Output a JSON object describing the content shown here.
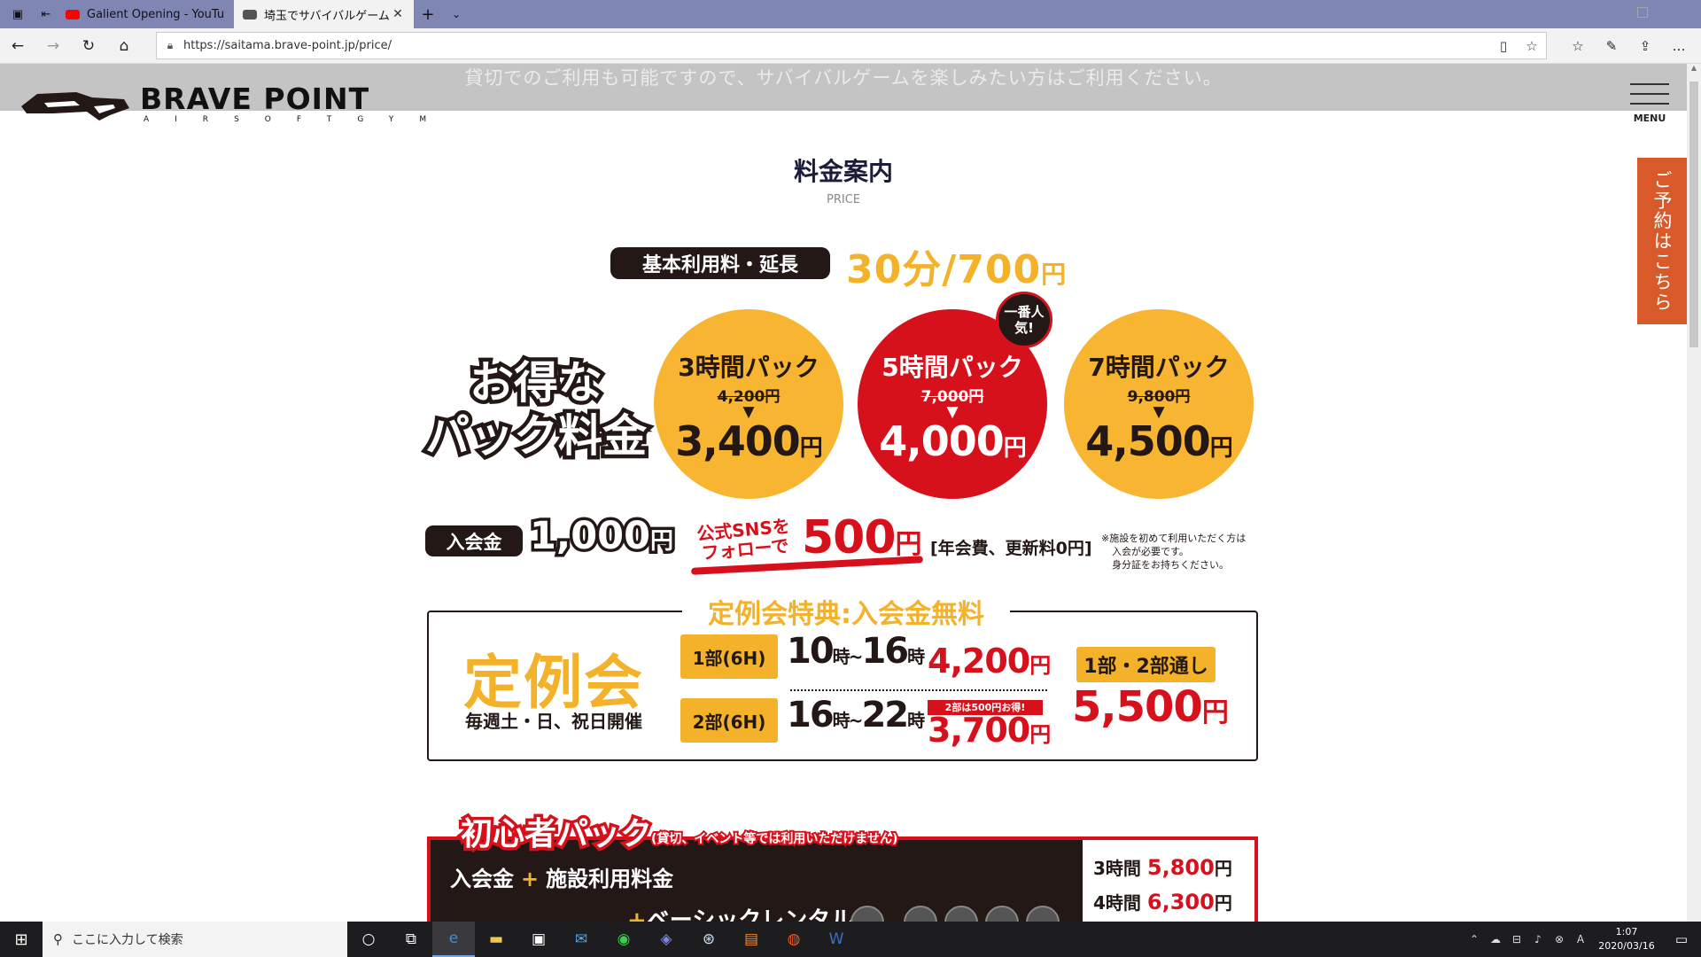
{
  "browser": {
    "tabs": [
      {
        "title": "Galient Opening - YouTube",
        "active": false
      },
      {
        "title": "埼玉でサバイバルゲームをす",
        "active": true
      }
    ],
    "url": "https://saitama.brave-point.jp/price/"
  },
  "site": {
    "header_message": "貸切でのご利用も可能ですので、サバイバルゲームを楽しみたい方はご利用ください。",
    "logo_text": "BRAVE POINT",
    "logo_sub": "AIRSOFTGYM",
    "menu_label": "MENU",
    "reserve_label": "ご予約はこちら"
  },
  "price_section": {
    "title": "料金案内",
    "subtitle": "PRICE",
    "basic_label": "基本利用料・延長",
    "basic_price": "30分/700",
    "basic_yen": "円",
    "pack_heading": "お得なパック料金",
    "packs": [
      {
        "name": "3時間パック",
        "old": "4,200円",
        "price": "3,400",
        "yen": "円"
      },
      {
        "name": "5時間パック",
        "old": "7,000円",
        "price": "4,000",
        "yen": "円"
      },
      {
        "name": "7時間パック",
        "old": "9,800円",
        "price": "4,500",
        "yen": "円"
      }
    ],
    "popular_badge": "一番人気!",
    "entry_label": "入会金",
    "entry_price": "1,000",
    "entry_yen": "円",
    "sns_label": "公式SNSをフォローで",
    "sns_price": "500",
    "sns_yen": "円",
    "sns_note": "[年会費、更新料0円]",
    "notice": [
      "※施設を初めて利用いただく方は",
      "入会が必要です。",
      "身分証をお持ちください。"
    ]
  },
  "regular": {
    "heading": "定例会特典:入会金無料",
    "title": "定例会",
    "days": "毎週土・日、祝日開催",
    "part1": {
      "label": "1部(6H)",
      "start": "10",
      "end": "16",
      "unit": "時",
      "price": "4,200",
      "yen": "円"
    },
    "part2": {
      "label": "2部(6H)",
      "start": "16",
      "end": "22",
      "unit": "時",
      "price": "3,700",
      "yen": "円",
      "tag": "2部は500円お得!"
    },
    "both_label": "1部・2部通し",
    "both_price": "5,500",
    "both_yen": "円"
  },
  "beginner": {
    "title": "初心者パック",
    "subtitle": "(貸切、イベント等では利用いただけません)",
    "line1_a": "入会金",
    "line1_b": "施設利用料金",
    "line2": "ベーシックレンタル",
    "prices": [
      {
        "label": "3時間",
        "value": "5,800",
        "yen": "円"
      },
      {
        "label": "4時間",
        "value": "6,300",
        "yen": "円"
      }
    ]
  },
  "taskbar": {
    "search_placeholder": "ここに入力して検索",
    "time": "1:07",
    "date": "2020/03/16"
  },
  "colors": {
    "yellow": "#f3b22a",
    "red": "#d7111c",
    "dark": "#231815",
    "reserve": "#d85a2a"
  }
}
